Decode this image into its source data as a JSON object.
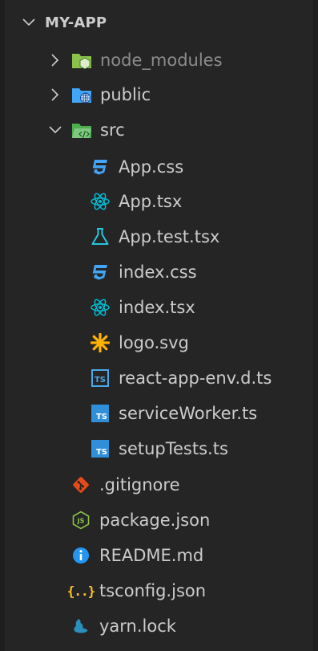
{
  "explorer": {
    "root_label": "MY-APP",
    "items": [
      {
        "label": "node_modules",
        "kind": "folder",
        "icon": "node-folder-icon",
        "expanded": false,
        "dim": true
      },
      {
        "label": "public",
        "kind": "folder",
        "icon": "public-folder-icon",
        "expanded": false
      },
      {
        "label": "src",
        "kind": "folder",
        "icon": "src-folder-icon",
        "expanded": true
      },
      {
        "label": "App.css",
        "kind": "file",
        "icon": "css-icon"
      },
      {
        "label": "App.tsx",
        "kind": "file",
        "icon": "react-icon"
      },
      {
        "label": "App.test.tsx",
        "kind": "file",
        "icon": "test-flask-icon"
      },
      {
        "label": "index.css",
        "kind": "file",
        "icon": "css-icon"
      },
      {
        "label": "index.tsx",
        "kind": "file",
        "icon": "react-icon"
      },
      {
        "label": "logo.svg",
        "kind": "file",
        "icon": "svg-asterisk-icon"
      },
      {
        "label": "react-app-env.d.ts",
        "kind": "file",
        "icon": "typescript-def-icon"
      },
      {
        "label": "serviceWorker.ts",
        "kind": "file",
        "icon": "typescript-icon"
      },
      {
        "label": "setupTests.ts",
        "kind": "file",
        "icon": "typescript-icon"
      },
      {
        "label": ".gitignore",
        "kind": "file",
        "icon": "git-icon"
      },
      {
        "label": "package.json",
        "kind": "file",
        "icon": "nodejs-icon"
      },
      {
        "label": "README.md",
        "kind": "file",
        "icon": "info-icon"
      },
      {
        "label": "tsconfig.json",
        "kind": "file",
        "icon": "json-braces-icon"
      },
      {
        "label": "yarn.lock",
        "kind": "file",
        "icon": "yarn-icon"
      }
    ],
    "icon_text": {
      "ts": "TS",
      "js": "JS",
      "braces": "{..}"
    },
    "colors": {
      "background": "#252526",
      "text": "#cccccc",
      "dim_text": "#8c8c8c",
      "css": "#42a5f5",
      "react": "#00bcd4",
      "test": "#26c6da",
      "svg": "#ffb300",
      "typescript": "#2f8fd8",
      "git": "#e64a19",
      "node": "#8bc34a",
      "info": "#2196f3",
      "json": "#fbc02d",
      "yarn": "#2c8ebb"
    }
  }
}
